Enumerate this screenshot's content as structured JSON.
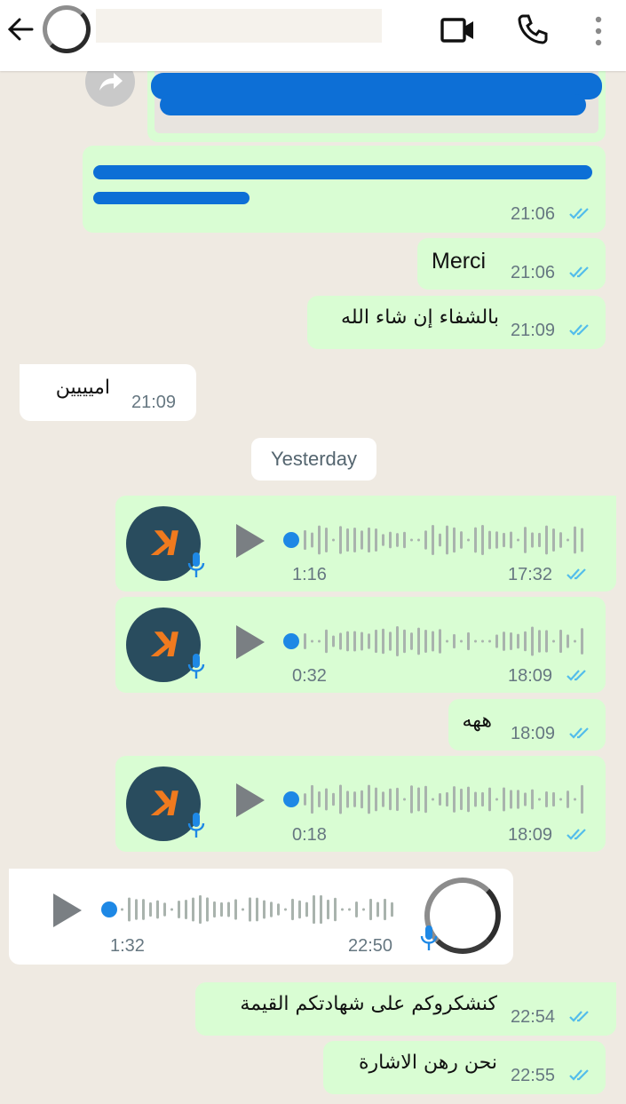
{
  "header": {
    "back_icon": "back-arrow-icon",
    "video_icon": "video-call-icon",
    "call_icon": "phone-call-icon",
    "menu_icon": "more-vert-icon"
  },
  "messages": {
    "m1": {
      "time": "21:06"
    },
    "m2": {
      "text": "Merci",
      "time": "21:06"
    },
    "m3": {
      "text": "بالشفاء إن شاء الله",
      "time": "21:09"
    },
    "m4": {
      "text": "اميييين",
      "time": "21:09"
    },
    "date_separator": "Yesterday",
    "v1": {
      "duration": "1:16",
      "time": "17:32"
    },
    "v2": {
      "duration": "0:32",
      "time": "18:09"
    },
    "m5": {
      "text": "ههه",
      "time": "18:09"
    },
    "v3": {
      "duration": "0:18",
      "time": "18:09"
    },
    "v4": {
      "duration": "1:32",
      "time": "22:50"
    },
    "m6": {
      "text": "كنشكروكم على شهادتكم القيمة",
      "time": "22:54"
    },
    "m7": {
      "text": "نحن رهن الاشارة",
      "time": "22:55"
    }
  },
  "colors": {
    "outgoing_bubble": "#d9fdd3",
    "incoming_bubble": "#ffffff",
    "read_ticks": "#53bdeb",
    "chat_background": "#efeae2",
    "redaction": "#0d6fd6"
  }
}
